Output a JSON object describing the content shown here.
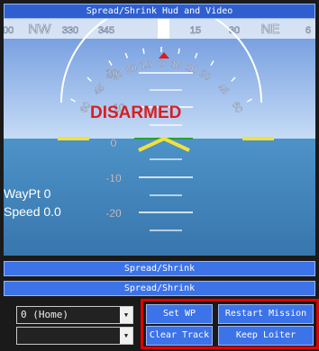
{
  "title": "Spread/Shrink Hud and Video",
  "hud": {
    "heading_marks": [
      "300",
      "NW",
      "330",
      "345",
      "0",
      "15",
      "30",
      "NE",
      "6"
    ],
    "roll_marks": [
      "60",
      "45",
      "30",
      "20",
      "10",
      "0",
      "10",
      "20",
      "30",
      "45",
      "60"
    ],
    "pitch_labels": [
      "20",
      "10",
      "0",
      "-10",
      "-20"
    ],
    "status": "DISARMED",
    "waypoint": "WayPt 0",
    "speed": "Speed 0.0",
    "colors": {
      "sky": "#9bc2ee",
      "ground": "#3f86c0",
      "alert": "#d81f1f",
      "marker": "#f0e040"
    }
  },
  "bars": [
    "Spread/Shrink",
    "Spread/Shrink"
  ],
  "controls": {
    "waypoint_select": "0 (Home)",
    "second_select": "",
    "buttons": {
      "set_wp": "Set WP",
      "restart_mission": "Restart Mission",
      "clear_track": "Clear Track",
      "keep_loiter": "Keep Loiter"
    }
  }
}
